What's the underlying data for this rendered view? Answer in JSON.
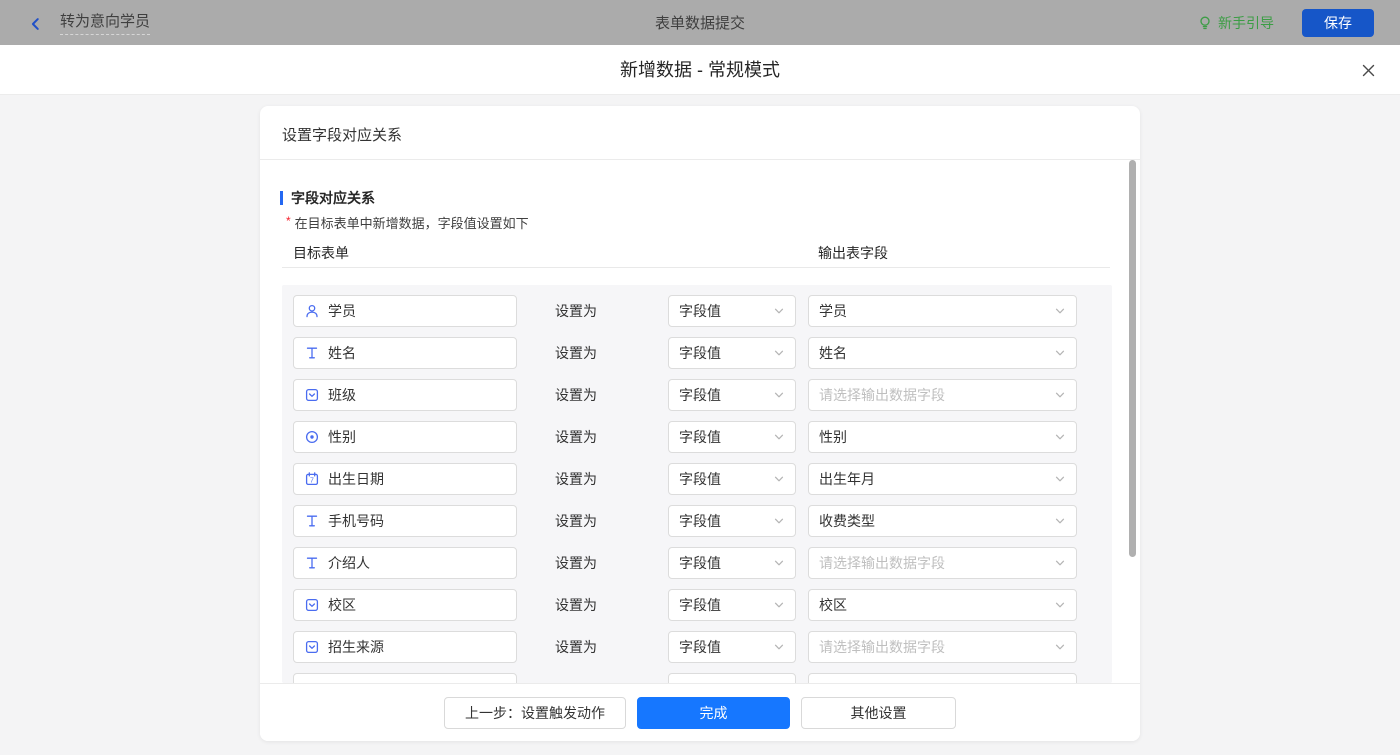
{
  "topbar": {
    "back_label": "转为意向学员",
    "title": "表单数据提交",
    "guide_label": "新手引导",
    "save_label": "保存"
  },
  "modal": {
    "title": "新增数据 - 常规模式",
    "close_icon": "close-icon"
  },
  "card": {
    "header": "设置字段对应关系",
    "section_title": "字段对应关系",
    "note_marker": "*",
    "note": "在目标表单中新增数据，字段值设置如下",
    "col_left": "目标表单",
    "col_right": "输出表字段",
    "set_as_label": "设置为",
    "output_placeholder": "请选择输出数据字段",
    "rows": [
      {
        "icon": "user",
        "field": "学员",
        "value": "字段值",
        "output": "学员",
        "placeholder": false
      },
      {
        "icon": "text",
        "field": "姓名",
        "value": "字段值",
        "output": "姓名",
        "placeholder": false
      },
      {
        "icon": "select",
        "field": "班级",
        "value": "字段值",
        "output": "请选择输出数据字段",
        "placeholder": true
      },
      {
        "icon": "radio",
        "field": "性别",
        "value": "字段值",
        "output": "性别",
        "placeholder": false
      },
      {
        "icon": "calendar",
        "field": "出生日期",
        "value": "字段值",
        "output": "出生年月",
        "placeholder": false
      },
      {
        "icon": "text",
        "field": "手机号码",
        "value": "字段值",
        "output": "收费类型",
        "placeholder": false
      },
      {
        "icon": "text",
        "field": "介绍人",
        "value": "字段值",
        "output": "请选择输出数据字段",
        "placeholder": true
      },
      {
        "icon": "select",
        "field": "校区",
        "value": "字段值",
        "output": "校区",
        "placeholder": false
      },
      {
        "icon": "select",
        "field": "招生来源",
        "value": "字段值",
        "output": "请选择输出数据字段",
        "placeholder": true
      },
      {
        "icon": "",
        "field": "",
        "value": "",
        "output": "",
        "placeholder": false
      }
    ],
    "footer": {
      "prev_label": "上一步：设置触发动作",
      "done_label": "完成",
      "other_label": "其他设置"
    }
  },
  "colors": {
    "topbar_bg": "#ababab",
    "save_blue": "#1656c8",
    "primary_blue": "#1677ff",
    "guide_green": "#3c9d45",
    "icon_blue": "#4a6cf0",
    "section_bar_blue": "#2468f2",
    "required_red": "#f5222d"
  }
}
